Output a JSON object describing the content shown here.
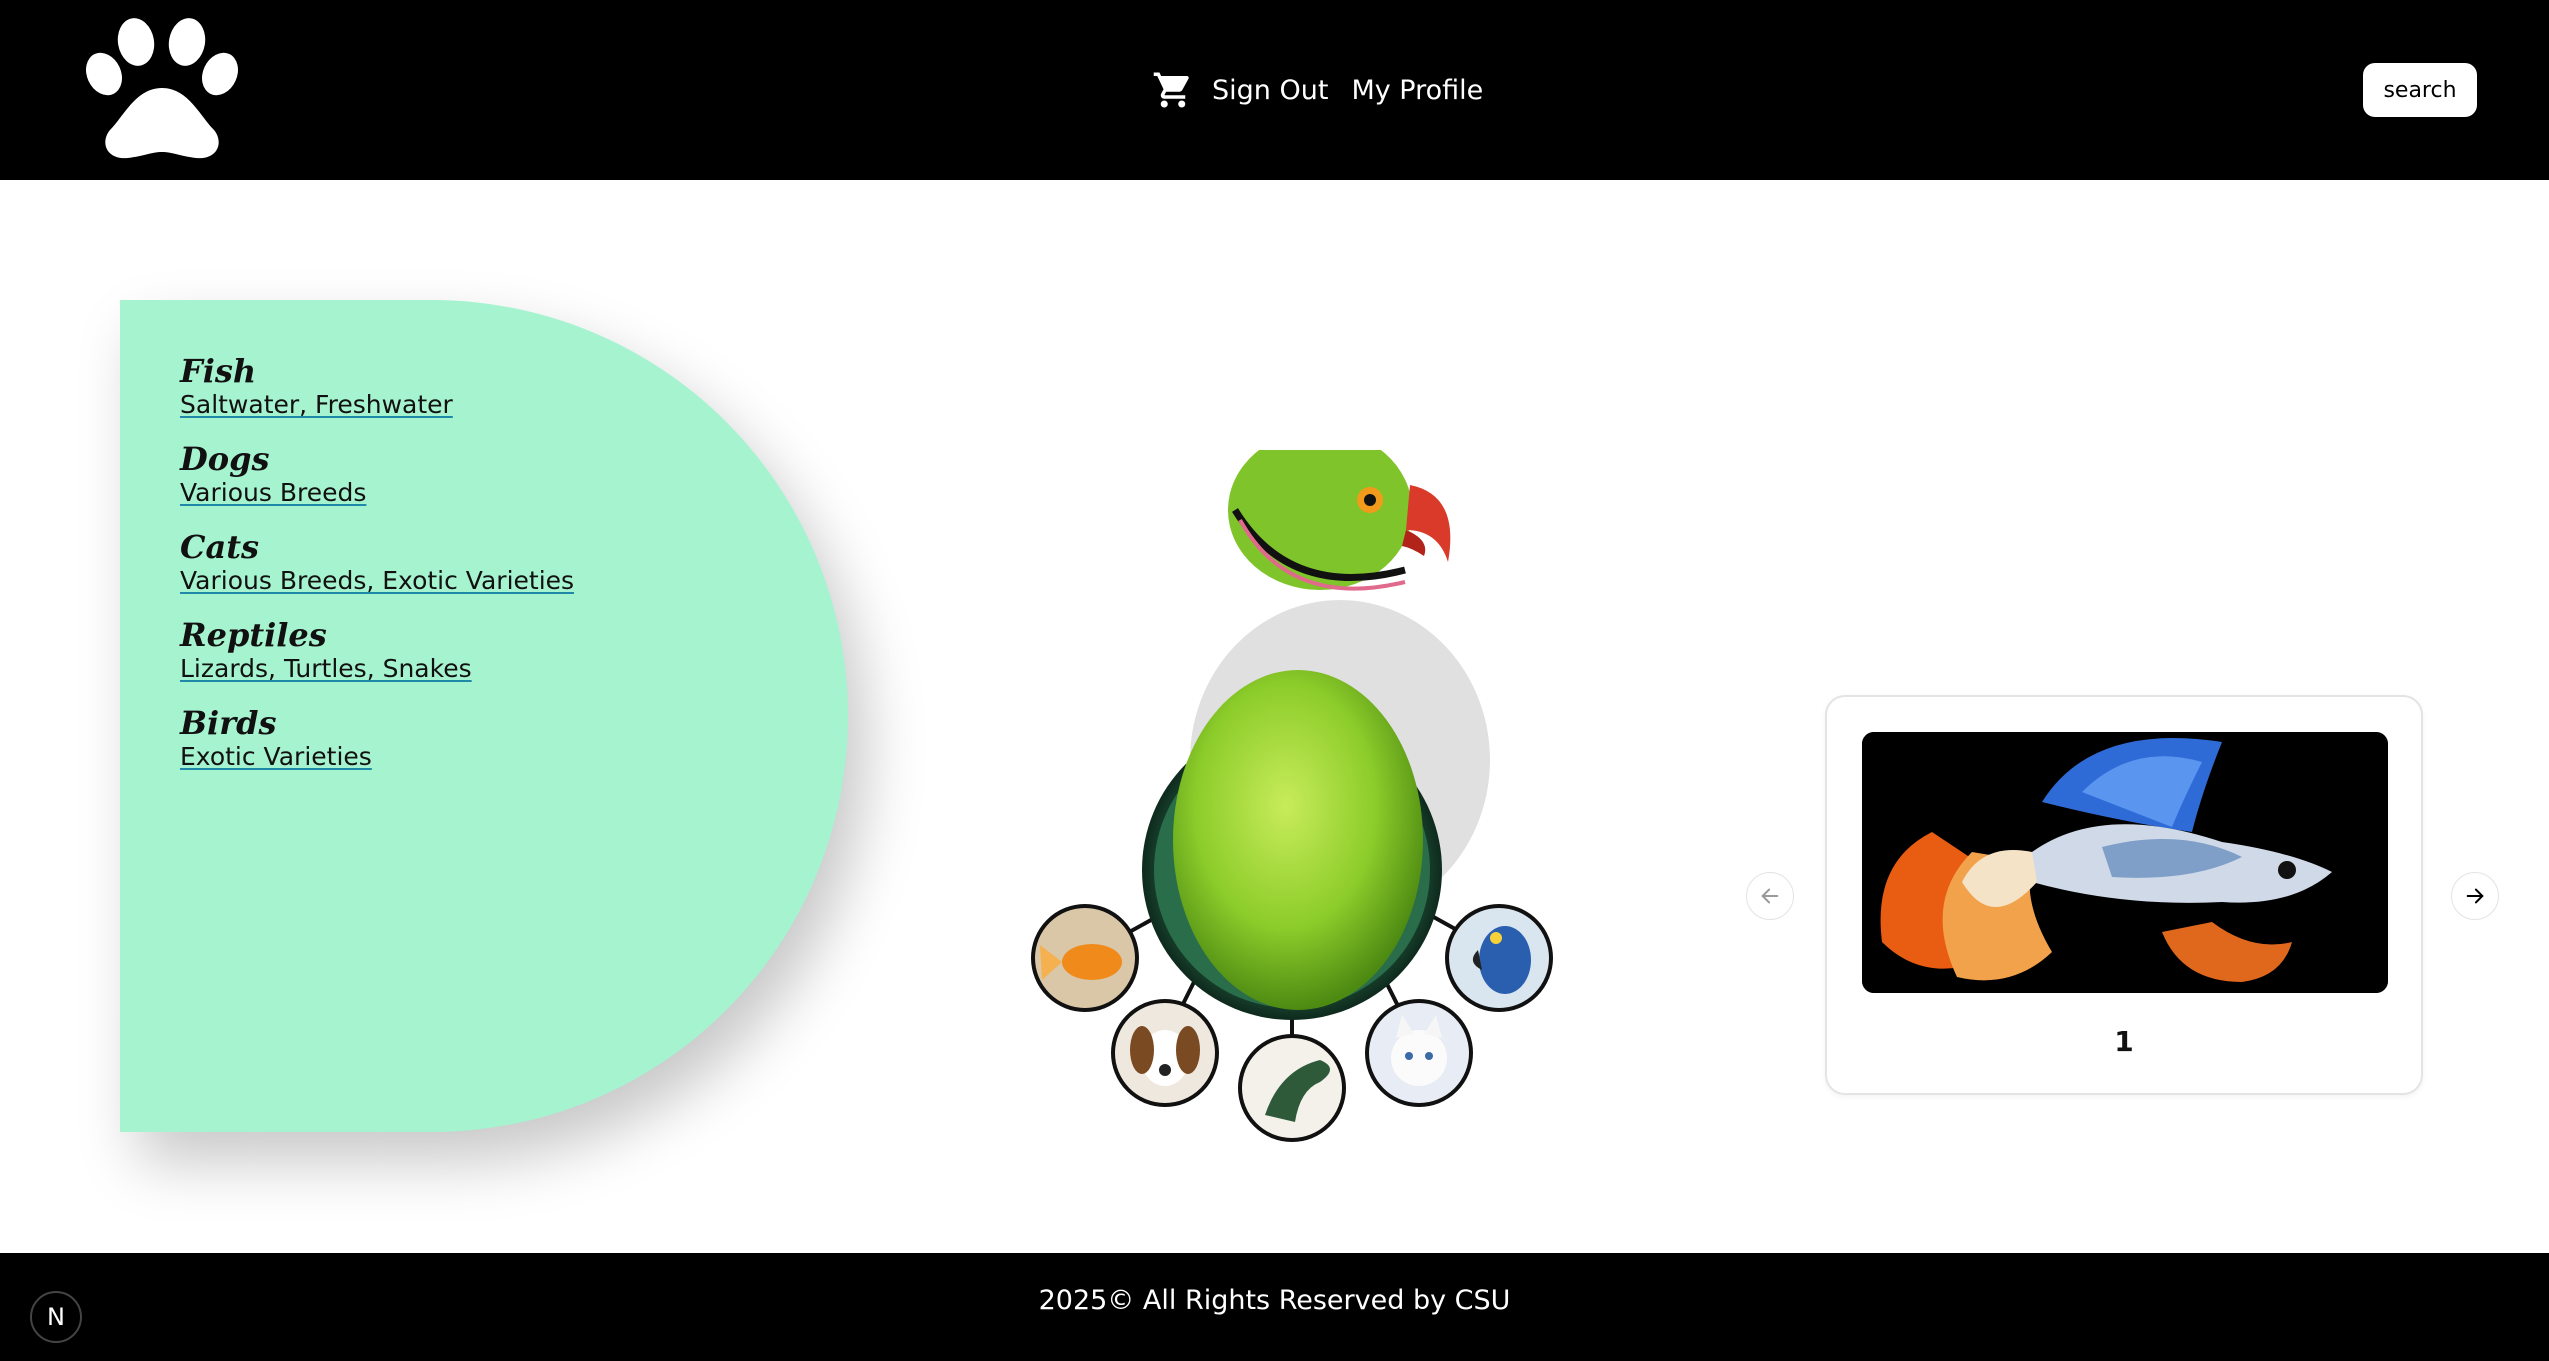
{
  "header": {
    "logo_icon": "paw-print-icon",
    "cart_icon": "shopping-cart-icon",
    "nav": {
      "sign_out": "Sign Out",
      "my_profile": "My Profile"
    },
    "search_button": "search"
  },
  "categories": [
    {
      "name": "Fish",
      "sub": "Saltwater, Freshwater"
    },
    {
      "name": "Dogs",
      "sub": "Various Breeds"
    },
    {
      "name": "Cats",
      "sub": "Various Breeds, Exotic Varieties"
    },
    {
      "name": "Reptiles",
      "sub": "Lizards, Turtles, Snakes"
    },
    {
      "name": "Birds",
      "sub": "Exotic Varieties"
    }
  ],
  "hero": {
    "image": "pets-parrot-collage"
  },
  "carousel": {
    "prev_icon": "arrow-left-icon",
    "next_icon": "arrow-right-icon",
    "card_label": "1",
    "card_image": "betta-fish-photo"
  },
  "footer": {
    "text": "2025© All Rights Reserved by CSU",
    "badge": "N"
  },
  "colors": {
    "header_bg": "#000000",
    "panel_bg": "#a6f3d0",
    "link_underline": "#1e8aa8"
  }
}
